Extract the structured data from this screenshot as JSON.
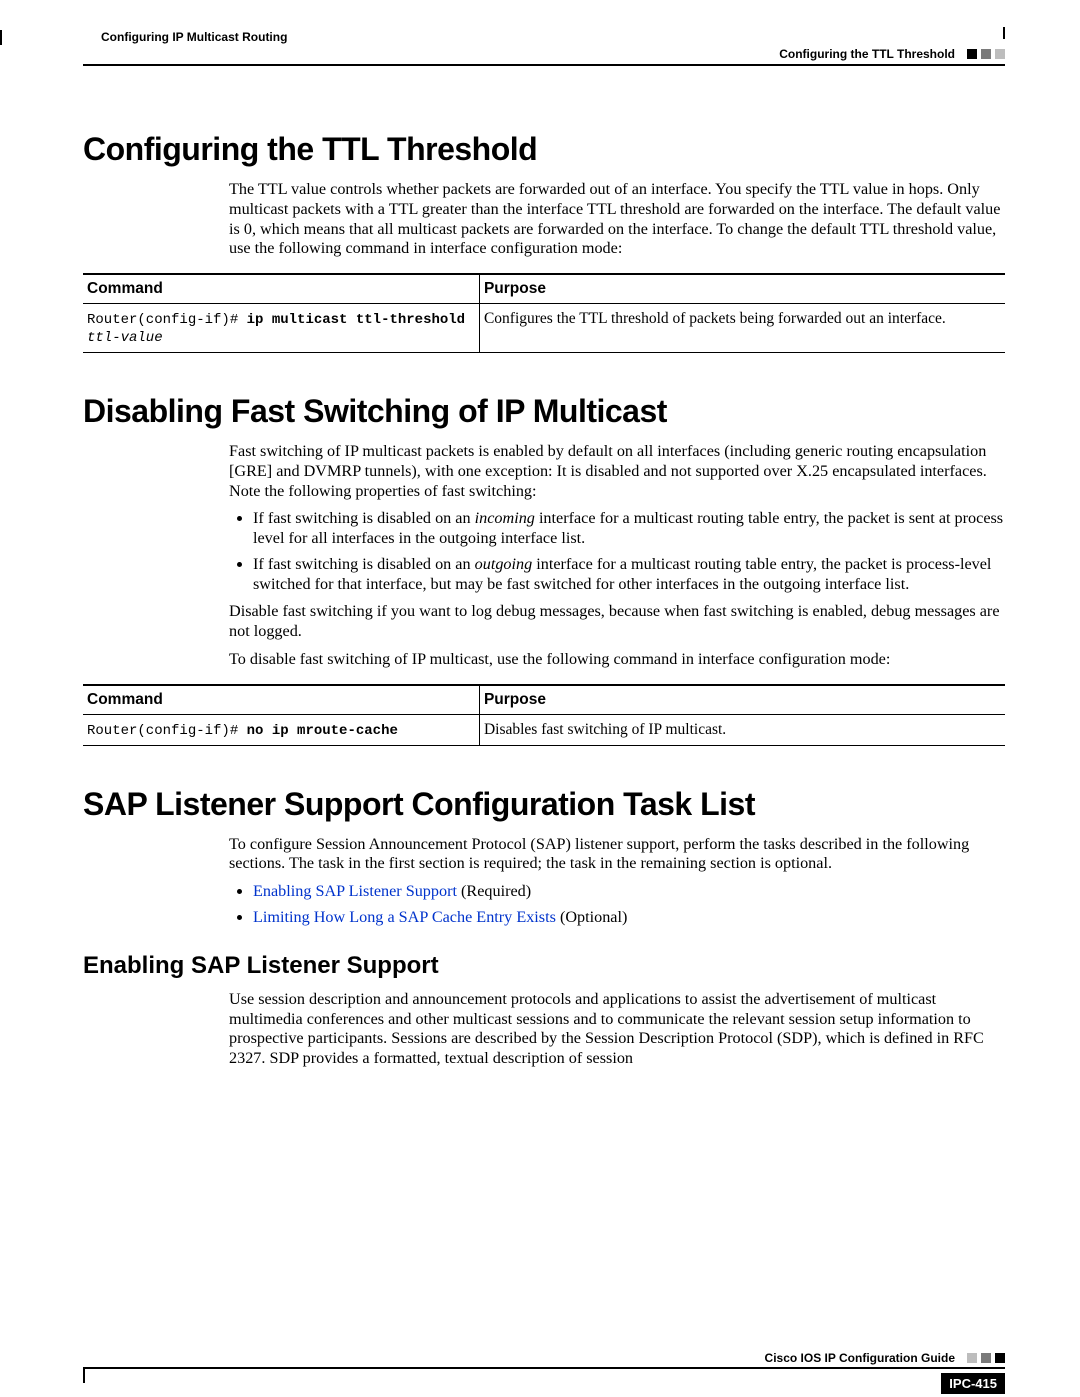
{
  "header": {
    "chapter": "Configuring IP Multicast Routing",
    "section": "Configuring the TTL Threshold"
  },
  "sec1": {
    "title": "Configuring the TTL Threshold",
    "para": "The TTL value controls whether packets are forwarded out of an interface. You specify the TTL value in hops. Only multicast packets with a TTL greater than the interface TTL threshold are forwarded on the interface. The default value is 0, which means that all multicast packets are forwarded on the interface. To change the default TTL threshold value, use the following command in interface configuration mode:",
    "table": {
      "h1": "Command",
      "h2": "Purpose",
      "cmd_prefix": "Router(config-if)# ",
      "cmd_bold": "ip multicast ttl-threshold",
      "cmd_arg": "ttl-value",
      "purpose": "Configures the TTL threshold of packets being forwarded out an interface."
    }
  },
  "sec2": {
    "title": "Disabling Fast Switching of IP Multicast",
    "para1": "Fast switching of IP multicast packets is enabled by default on all interfaces (including generic routing encapsulation [GRE] and DVMRP tunnels), with one exception: It is disabled and not supported over X.25 encapsulated interfaces. Note the following properties of fast switching:",
    "b1a": "If fast switching is disabled on an ",
    "b1i": "incoming",
    "b1b": " interface for a multicast routing table entry, the packet is sent at process level for all interfaces in the outgoing interface list.",
    "b2a": "If fast switching is disabled on an ",
    "b2i": "outgoing",
    "b2b": " interface for a multicast routing table entry, the packet is process-level switched for that interface, but may be fast switched for other interfaces in the outgoing interface list.",
    "para2": "Disable fast switching if you want to log debug messages, because when fast switching is enabled, debug messages are not logged.",
    "para3": "To disable fast switching of IP multicast, use the following command in interface configuration mode:",
    "table": {
      "h1": "Command",
      "h2": "Purpose",
      "cmd_prefix": "Router(config-if)# ",
      "cmd_bold": "no ip mroute-cache",
      "purpose": "Disables fast switching of IP multicast."
    }
  },
  "sec3": {
    "title": "SAP Listener Support Configuration Task List",
    "para": "To configure Session Announcement Protocol (SAP) listener support, perform the tasks described in the following sections. The task in the first section is required; the task in the remaining section is optional.",
    "link1": "Enabling SAP Listener Support",
    "link1_suffix": " (Required)",
    "link2": "Limiting How Long a SAP Cache Entry Exists",
    "link2_suffix": " (Optional)",
    "sub": {
      "title": "Enabling SAP Listener Support",
      "para": "Use session description and announcement protocols and applications to assist the advertisement of multicast multimedia conferences and other multicast sessions and to communicate the relevant session setup information to prospective participants. Sessions are described by the Session Description Protocol (SDP), which is defined in RFC 2327. SDP provides a formatted, textual description of session"
    }
  },
  "footer": {
    "guide": "Cisco IOS IP Configuration Guide",
    "page": "IPC-415"
  }
}
